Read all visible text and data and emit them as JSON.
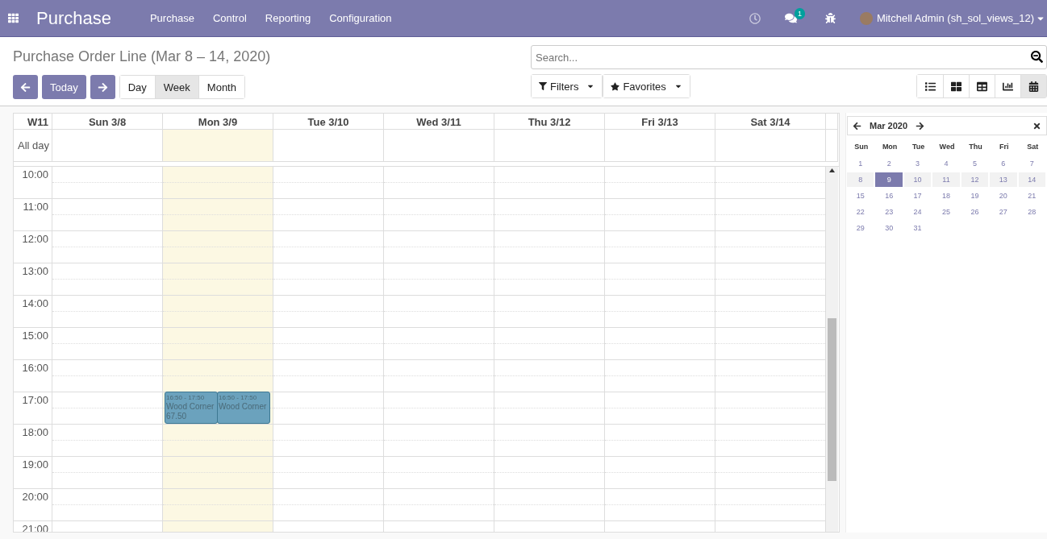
{
  "navbar": {
    "app_title": "Purchase",
    "menu": [
      "Purchase",
      "Control",
      "Reporting",
      "Configuration"
    ],
    "messages_badge": "1",
    "user": "Mitchell Admin (sh_sol_views_12)"
  },
  "control_panel": {
    "title": "Purchase Order Line (Mar 8 – 14, 2020)",
    "today_button": "Today",
    "scales": [
      {
        "label": "Day",
        "selected": false
      },
      {
        "label": "Week",
        "selected": true
      },
      {
        "label": "Month",
        "selected": false
      }
    ],
    "search": {
      "placeholder": "Search..."
    },
    "filters": "Filters",
    "favorites": "Favorites",
    "views": [
      {
        "kind": "list",
        "selected": false
      },
      {
        "kind": "kanban",
        "selected": false
      },
      {
        "kind": "pivot",
        "selected": false
      },
      {
        "kind": "graph",
        "selected": false
      },
      {
        "kind": "calendar",
        "selected": true
      }
    ]
  },
  "calendar": {
    "week_label": "W11",
    "allday_label": "All day",
    "days": [
      {
        "label": "Sun 3/8",
        "today": false
      },
      {
        "label": "Mon 3/9",
        "today": true,
        "events": [
          {
            "time": "16:50 - 17:50",
            "title": "Wood Corner",
            "amount": "67.50"
          },
          {
            "time": "16:50 - 17:50",
            "title": "Wood Corner"
          }
        ]
      },
      {
        "label": "Tue 3/10",
        "today": false
      },
      {
        "label": "Wed 3/11",
        "today": false
      },
      {
        "label": "Thu 3/12",
        "today": false
      },
      {
        "label": "Fri 3/13",
        "today": false
      },
      {
        "label": "Sat 3/14",
        "today": false
      }
    ],
    "hours": [
      "10:00",
      "11:00",
      "12:00",
      "13:00",
      "14:00",
      "15:00",
      "16:00",
      "17:00",
      "18:00",
      "19:00",
      "20:00",
      "21:00"
    ]
  },
  "mini_calendar": {
    "month": "Mar 2020",
    "weekdays": [
      "Sun",
      "Mon",
      "Tue",
      "Wed",
      "Thu",
      "Fri",
      "Sat"
    ],
    "weeks": [
      {
        "highlighted": false,
        "days": [
          {
            "label": "1",
            "selected": false
          },
          {
            "label": "2",
            "selected": false
          },
          {
            "label": "3",
            "selected": false
          },
          {
            "label": "4",
            "selected": false
          },
          {
            "label": "5",
            "selected": false
          },
          {
            "label": "6",
            "selected": false
          },
          {
            "label": "7",
            "selected": false
          }
        ]
      },
      {
        "highlighted": true,
        "days": [
          {
            "label": "8",
            "selected": false
          },
          {
            "label": "9",
            "selected": true
          },
          {
            "label": "10",
            "selected": false
          },
          {
            "label": "11",
            "selected": false
          },
          {
            "label": "12",
            "selected": false
          },
          {
            "label": "13",
            "selected": false
          },
          {
            "label": "14",
            "selected": false
          }
        ]
      },
      {
        "highlighted": false,
        "days": [
          {
            "label": "15",
            "selected": false
          },
          {
            "label": "16",
            "selected": false
          },
          {
            "label": "17",
            "selected": false
          },
          {
            "label": "18",
            "selected": false
          },
          {
            "label": "19",
            "selected": false
          },
          {
            "label": "20",
            "selected": false
          },
          {
            "label": "21",
            "selected": false
          }
        ]
      },
      {
        "highlighted": false,
        "days": [
          {
            "label": "22",
            "selected": false
          },
          {
            "label": "23",
            "selected": false
          },
          {
            "label": "24",
            "selected": false
          },
          {
            "label": "25",
            "selected": false
          },
          {
            "label": "26",
            "selected": false
          },
          {
            "label": "27",
            "selected": false
          },
          {
            "label": "28",
            "selected": false
          }
        ]
      },
      {
        "highlighted": false,
        "days": [
          {
            "label": "29",
            "selected": false
          },
          {
            "label": "30",
            "selected": false
          },
          {
            "label": "31",
            "selected": false
          }
        ]
      }
    ]
  }
}
